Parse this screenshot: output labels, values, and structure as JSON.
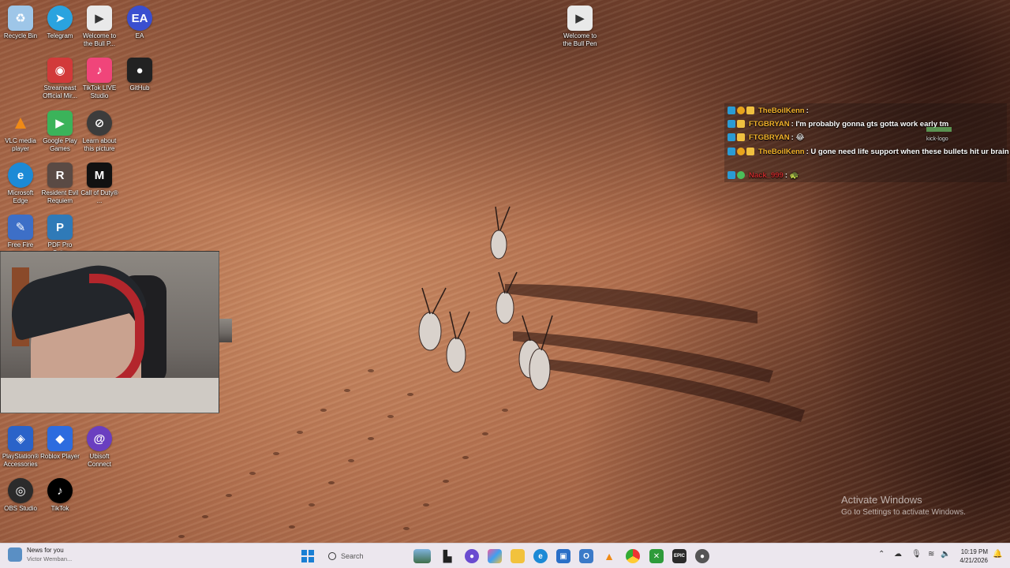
{
  "desktop": {
    "icons": [
      {
        "label": "Recycle Bin",
        "icon": "recycle-bin-icon",
        "color": "#9ec6e8"
      },
      {
        "label": "Telegram",
        "icon": "telegram-icon",
        "color": "#2aa3df"
      },
      {
        "label": "Welcome to the Bull P...",
        "icon": "video-file-icon",
        "color": "#e9e9e9"
      },
      {
        "label": "EA",
        "icon": "ea-icon",
        "color": "#3a4fd0"
      },
      {
        "label": "Streameast Official Mir...",
        "icon": "chrome-app-icon",
        "color": "#d23a3a"
      },
      {
        "label": "TikTok LIVE Studio",
        "icon": "tiktok-live-icon",
        "color": "#f0457a"
      },
      {
        "label": "GitHub",
        "icon": "github-icon",
        "color": "#222222"
      },
      {
        "label": "VLC media player",
        "icon": "vlc-icon",
        "color": "#f08a16"
      },
      {
        "label": "Google Play Games",
        "icon": "google-play-games-icon",
        "color": "#3bb35a"
      },
      {
        "label": "Learn about this picture",
        "icon": "learn-picture-icon",
        "color": "#3c3c3c"
      },
      {
        "label": "Microsoft Edge",
        "icon": "edge-icon",
        "color": "#1c8ad6"
      },
      {
        "label": "Resident Evil Requiem",
        "icon": "resident-evil-icon",
        "color": "#5a4a44"
      },
      {
        "label": "Call of Duty® ...",
        "icon": "call-of-duty-icon",
        "color": "#111111"
      },
      {
        "label": "Free Fire",
        "icon": "free-fire-icon",
        "color": "#3d6fc7"
      },
      {
        "label": "PDF Pro Suite",
        "icon": "pdf-pro-icon",
        "color": "#2f7ab8"
      },
      {
        "label": "PlayStation® Accessories",
        "icon": "playstation-icon",
        "color": "#2a63c9"
      },
      {
        "label": "Roblox Player",
        "icon": "roblox-icon",
        "color": "#2d6cdf"
      },
      {
        "label": "Ubisoft Connect",
        "icon": "ubisoft-icon",
        "color": "#6a3fc0"
      },
      {
        "label": "OBS Studio",
        "icon": "obs-icon",
        "color": "#2b2b2b"
      },
      {
        "label": "TikTok",
        "icon": "tiktok-icon",
        "color": "#000000"
      }
    ],
    "welcome_file": {
      "label": "Welcome to the Bull Pen",
      "icon": "video-file-icon"
    }
  },
  "chat": {
    "messages": [
      {
        "user": "TheBoilKenn",
        "text": " :",
        "user_color": "#f2b22a"
      },
      {
        "user": "FTGBRYAN",
        "text": " : I'm probably gonna gts gotta work early tm",
        "user_color": "#f2b22a"
      },
      {
        "user": "FTGBRYAN",
        "text": " : 😂",
        "user_color": "#f2b22a"
      },
      {
        "user": "TheBoilKenn",
        "text": " : U gone need life support when these bullets hit ur brain",
        "user_color": "#f2b22a"
      },
      {
        "user": "Nack_999",
        "text": " : 🐢",
        "user_color": "#c52a2a"
      }
    ],
    "kick_logo_label": "kick-logo"
  },
  "watermark": {
    "title": "Activate Windows",
    "subtitle": "Go to Settings to activate Windows."
  },
  "taskbar": {
    "news_title": "News for you",
    "news_subtitle": "Victor Wemban...",
    "search_placeholder": "Search",
    "time": "10:19 PM",
    "date": "4/21/2026"
  }
}
